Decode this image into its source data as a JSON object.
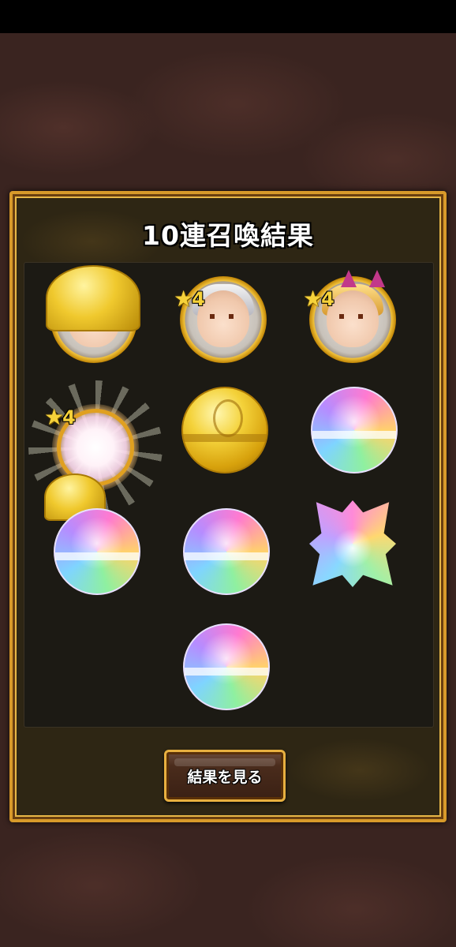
{
  "title": "10連召喚結果",
  "results": [
    {
      "kind": "gold-capsule-opening"
    },
    {
      "kind": "character",
      "rarity": "4",
      "hair": "white"
    },
    {
      "kind": "character",
      "rarity": "4",
      "hair": "blonde"
    },
    {
      "kind": "character-reveal",
      "rarity": "4"
    },
    {
      "kind": "gold-capsule"
    },
    {
      "kind": "rainbow-capsule"
    },
    {
      "kind": "rainbow-capsule"
    },
    {
      "kind": "rainbow-capsule"
    },
    {
      "kind": "rainbow-crest-capsule"
    },
    {
      "kind": "rainbow-capsule"
    }
  ],
  "badges": {
    "star_icon": "star-icon",
    "b1": "4",
    "b2": "4",
    "b3": "4"
  },
  "button": {
    "label": "結果を見る"
  },
  "colors": {
    "frame": "#d89a2a",
    "panel": "#2e2614",
    "star": "#f6d23a"
  }
}
